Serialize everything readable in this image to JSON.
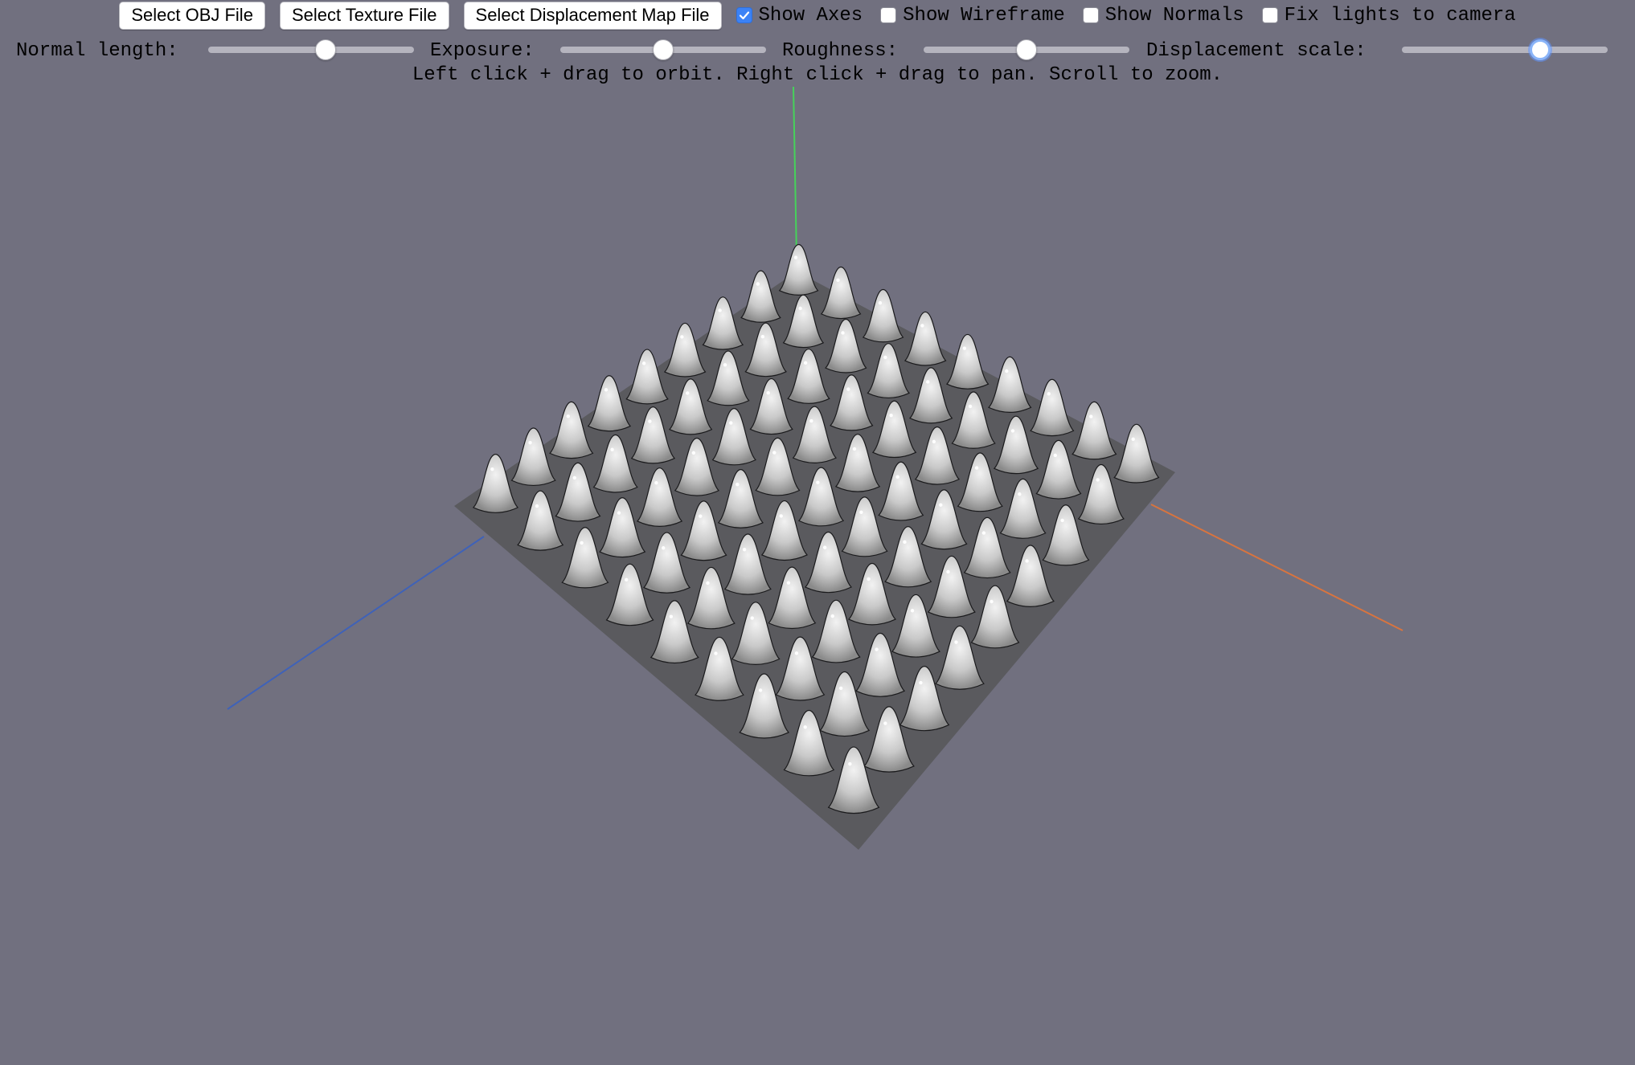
{
  "toolbar": {
    "obj_button": "Select OBJ File",
    "texture_button": "Select Texture File",
    "displacement_button": "Select Displacement Map File",
    "show_axes": {
      "label": "Show Axes",
      "checked": true
    },
    "show_wireframe": {
      "label": "Show Wireframe",
      "checked": false
    },
    "show_normals": {
      "label": "Show Normals",
      "checked": false
    },
    "fix_lights": {
      "label": "Fix lights to camera",
      "checked": false
    }
  },
  "sliders": {
    "normal_length": {
      "label": "Normal length:",
      "value": 0.58
    },
    "exposure": {
      "label": "Exposure:",
      "value": 0.5
    },
    "roughness": {
      "label": "Roughness:",
      "value": 0.5
    },
    "displacement_scale": {
      "label": "Displacement scale:",
      "value": 0.69
    }
  },
  "hint": "Left click + drag to orbit. Right click + drag to pan. Scroll to zoom.",
  "colors": {
    "background": "#71707f",
    "axis_x": "#d8743f",
    "axis_y": "#46d25a",
    "axis_z": "#3f62b8",
    "accent": "#3b82f6",
    "surface": "#c8c8c8"
  }
}
